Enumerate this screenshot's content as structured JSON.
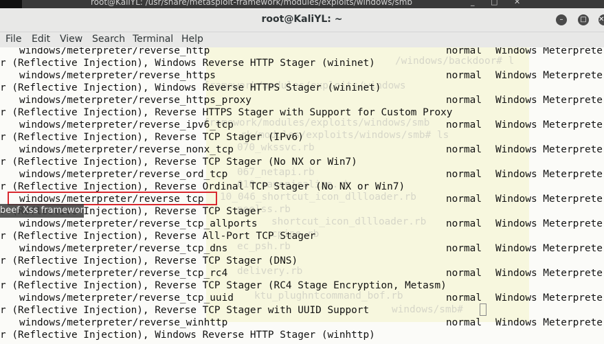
{
  "background_window": {
    "title": "root@KaliYL: /usr/share/metasploit-framework/modules/exploits/windows/smb",
    "controls": [
      "_",
      "□",
      "✕"
    ]
  },
  "window": {
    "title": "root@KaliYL: ~",
    "controls": {
      "minimize": "–",
      "maximize": "□",
      "close": "✕"
    }
  },
  "menu": [
    "File",
    "Edit",
    "View",
    "Search",
    "Terminal",
    "Help"
  ],
  "ghost_lines": [
    "/windows/backdoor# l",
    "framework/modules/exploits/windows",
    "framework/modules/exploits/windows/smb",
    "rk/modules/exploits/windows/smb# ls",
    "070_wkssvc.rb",
    "067_netapi.rb",
    "010 canonicalize.rb",
    "10_046_shortcut_icon_dllloader.rb",
    "poolss.rb",
    "shortcut_icon_dllloader.rb",
    "cpipe.rb",
    "ec_psh.rb",
    "delivery.rb",
    "ktu_plughntcommand_bof.rb",
    "windows/smb#"
  ],
  "terminal_rows": [
    {
      "type": "module",
      "name": "windows/meterpreter/reverse_http",
      "rank": "normal",
      "desc": "Windows Meterprete"
    },
    {
      "type": "sub",
      "text": "r (Reflective Injection), Windows Reverse HTTP Stager (wininet)"
    },
    {
      "type": "module",
      "name": "windows/meterpreter/reverse_https",
      "rank": "normal",
      "desc": "Windows Meterprete"
    },
    {
      "type": "sub",
      "text": "r (Reflective Injection), Windows Reverse HTTPS Stager (wininet)"
    },
    {
      "type": "module",
      "name": "windows/meterpreter/reverse_https_proxy",
      "rank": "normal",
      "desc": "Windows Meterprete"
    },
    {
      "type": "sub",
      "text": "r (Reflective Injection), Reverse HTTPS Stager with Support for Custom Proxy"
    },
    {
      "type": "module",
      "name": "windows/meterpreter/reverse_ipv6_tcp",
      "rank": "normal",
      "desc": "Windows Meterprete"
    },
    {
      "type": "sub",
      "text": "r (Reflective Injection), Reverse TCP Stager (IPv6)"
    },
    {
      "type": "module",
      "name": "windows/meterpreter/reverse_nonx_tcp",
      "rank": "normal",
      "desc": "Windows Meterprete"
    },
    {
      "type": "sub",
      "text": "r (Reflective Injection), Reverse TCP Stager (No NX or Win7)"
    },
    {
      "type": "module",
      "name": "windows/meterpreter/reverse_ord_tcp",
      "rank": "normal",
      "desc": "Windows Meterprete"
    },
    {
      "type": "sub",
      "text": "r (Reflective Injection), Reverse Ordinal TCP Stager (No NX or Win7)"
    },
    {
      "type": "module",
      "name": "windows/meterpreter/reverse_tcp",
      "rank": "normal",
      "desc": "Windows Meterprete"
    },
    {
      "type": "sub",
      "text": "r (Reflective Injection), Reverse TCP Stager"
    },
    {
      "type": "module",
      "name": "windows/meterpreter/reverse_tcp_allports",
      "rank": "normal",
      "desc": "Windows Meterprete"
    },
    {
      "type": "sub",
      "text": "r (Reflective Injection), Reverse All-Port TCP Stager"
    },
    {
      "type": "module",
      "name": "windows/meterpreter/reverse_tcp_dns",
      "rank": "normal",
      "desc": "Windows Meterprete"
    },
    {
      "type": "sub",
      "text": "r (Reflective Injection), Reverse TCP Stager (DNS)"
    },
    {
      "type": "module",
      "name": "windows/meterpreter/reverse_tcp_rc4",
      "rank": "normal",
      "desc": "Windows Meterprete"
    },
    {
      "type": "sub",
      "text": "r (Reflective Injection), Reverse TCP Stager (RC4 Stage Encryption, Metasm)"
    },
    {
      "type": "module",
      "name": "windows/meterpreter/reverse_tcp_uuid",
      "rank": "normal",
      "desc": "Windows Meterprete"
    },
    {
      "type": "sub",
      "text": "r (Reflective Injection), Reverse TCP Stager with UUID Support"
    },
    {
      "type": "module",
      "name": "windows/meterpreter/reverse_winhttp",
      "rank": "normal",
      "desc": "Windows Meterprete"
    },
    {
      "type": "sub",
      "text": "r (Reflective Injection), Windows Reverse HTTP Stager (winhttp)"
    }
  ],
  "tooltip": "beef Xss framework"
}
